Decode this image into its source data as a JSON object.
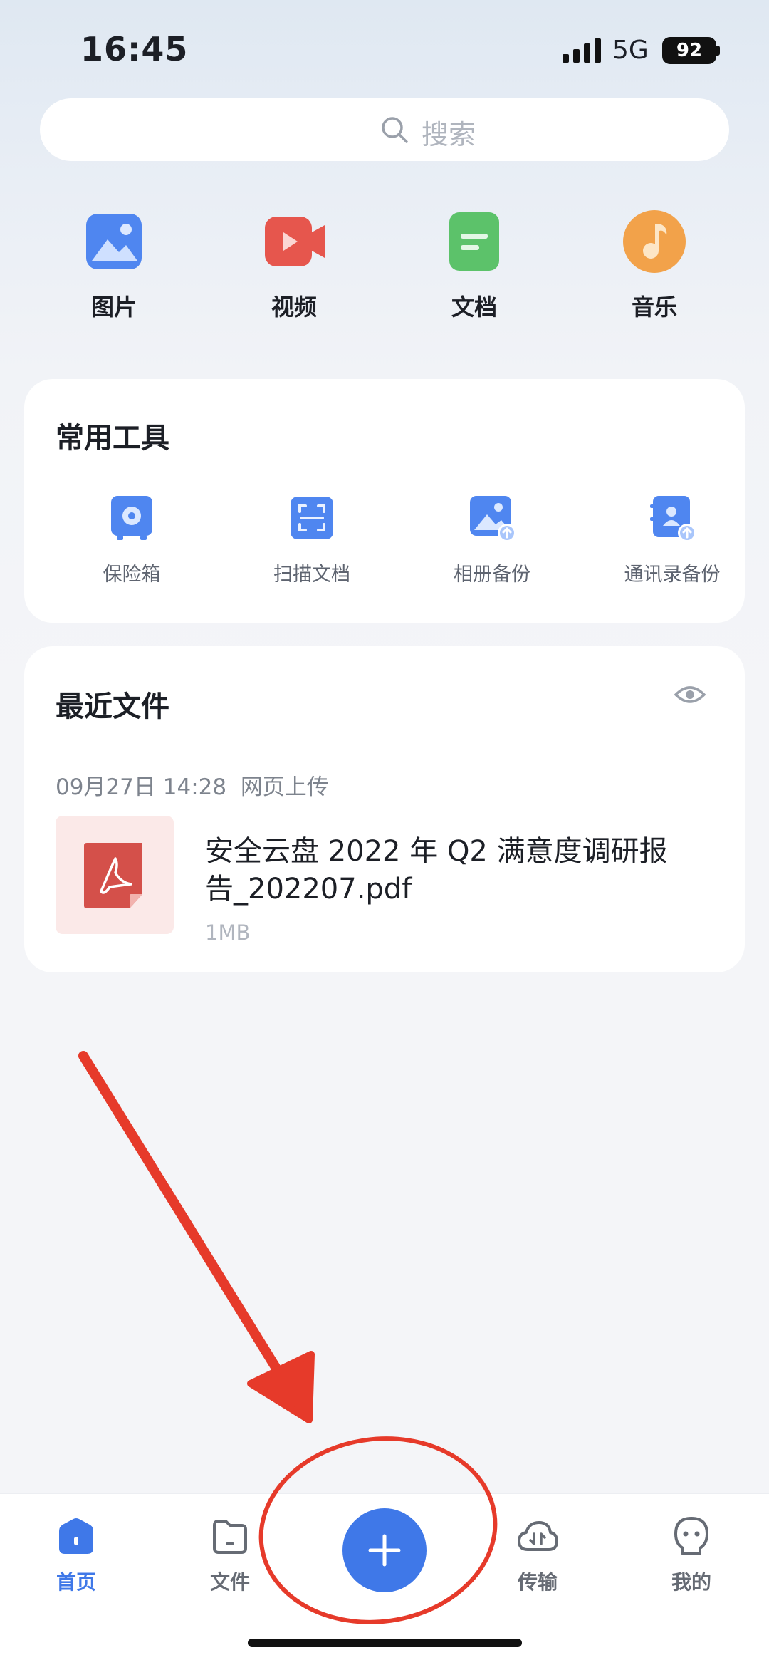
{
  "status_bar": {
    "time": "16:45",
    "network": "5G",
    "battery": "92"
  },
  "search": {
    "placeholder": "搜索"
  },
  "categories": [
    {
      "label": "图片",
      "icon": "image-icon",
      "color": "#4f86f0"
    },
    {
      "label": "视频",
      "icon": "video-icon",
      "color": "#e6564d"
    },
    {
      "label": "文档",
      "icon": "document-icon",
      "color": "#5cc26a"
    },
    {
      "label": "音乐",
      "icon": "music-icon",
      "color": "#f2a24a"
    }
  ],
  "tools": {
    "title": "常用工具",
    "items": [
      {
        "label": "保险箱",
        "icon": "safe-icon"
      },
      {
        "label": "扫描文档",
        "icon": "scan-icon"
      },
      {
        "label": "相册备份",
        "icon": "album-backup-icon"
      },
      {
        "label": "通讯录备份",
        "icon": "contacts-backup-icon"
      }
    ]
  },
  "recent": {
    "title": "最近文件",
    "date": "09月27日 14:28",
    "source": "网页上传",
    "file": {
      "name": "安全云盘 2022 年 Q2 满意度调研报告_202207.pdf",
      "size": "1MB"
    }
  },
  "nav": {
    "items": [
      {
        "label": "首页",
        "icon": "home-icon",
        "active": true
      },
      {
        "label": "文件",
        "icon": "folder-icon",
        "active": false
      },
      {
        "label": "传输",
        "icon": "cloud-transfer-icon",
        "active": false
      },
      {
        "label": "我的",
        "icon": "profile-icon",
        "active": false
      }
    ],
    "add_icon": "plus-icon"
  },
  "colors": {
    "accent": "#3f78e8",
    "annotation": "#e63a2a"
  }
}
